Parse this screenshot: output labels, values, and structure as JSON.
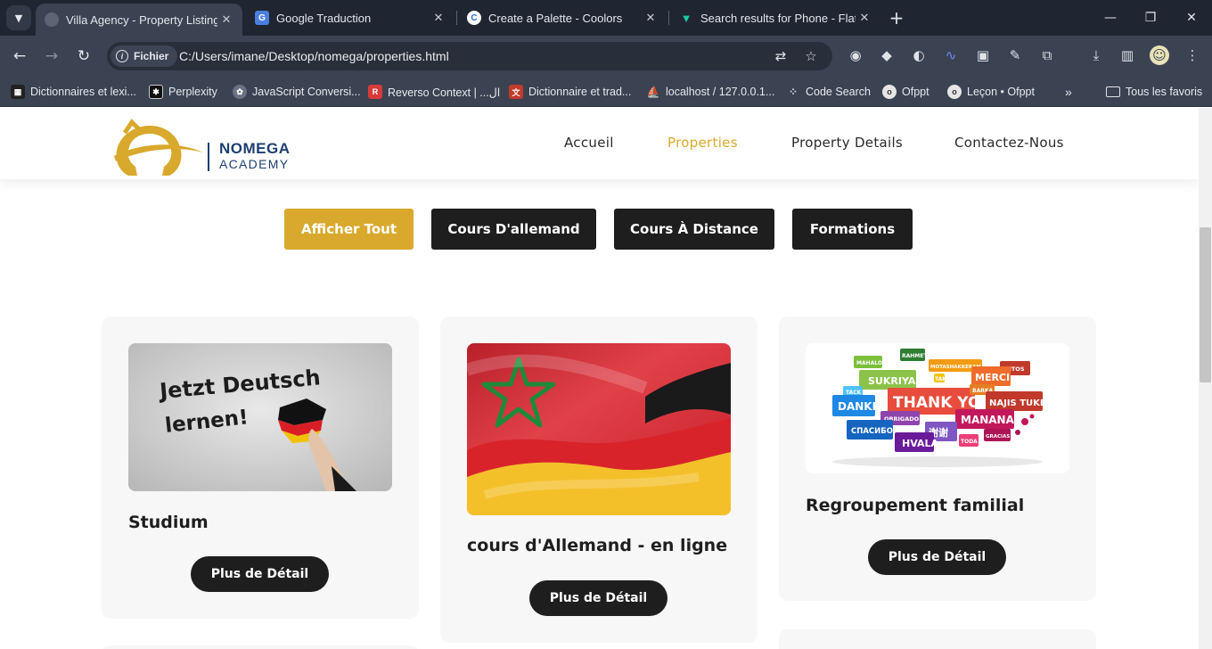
{
  "browser": {
    "tabs": [
      {
        "title": "Villa Agency - Property Listing I",
        "active": true
      },
      {
        "title": "Google Traduction",
        "active": false
      },
      {
        "title": "Create a Palette - Coolors",
        "active": false
      },
      {
        "title": "Search results for Phone - Flatic",
        "active": false
      }
    ],
    "address": {
      "chip_label": "Fichier",
      "url": "C:/Users/imane/Desktop/nomega/properties.html"
    },
    "bookmarks": [
      "Dictionnaires et lexi...",
      "Perplexity",
      "JavaScript Conversi...",
      "Reverso Context | ...ال",
      "Dictionnaire et trad...",
      "localhost / 127.0.0.1...",
      "Code Search",
      "Ofppt",
      "Leçon • Ofppt"
    ],
    "all_bookmarks_label": "Tous les favoris"
  },
  "site": {
    "logo": {
      "line1": "NOMEGA",
      "line2": "ACADEMY"
    },
    "nav": [
      "Accueil",
      "Properties",
      "Property Details",
      "Contactez-Nous"
    ],
    "active_nav": "Properties",
    "filters": [
      "Afficher Tout",
      "Cours D'allemand",
      "Cours À Distance",
      "Formations"
    ],
    "active_filter": "Afficher Tout",
    "cards": [
      {
        "title": "Studium",
        "image_text": [
          "Jetzt Deutsch",
          "lernen!"
        ],
        "button": "Plus de Détail"
      },
      {
        "title": "cours d'Allemand - en ligne",
        "button": "Plus de Détail"
      },
      {
        "title": "Regroupement familial",
        "image_words": [
          "THANK YOU",
          "DANKE",
          "MERCI",
          "SUKRIYA",
          "NAJIS TUKE",
          "MANANA",
          "СПАСИБО",
          "HVALA",
          "OBRIGADO",
          "TACK",
          "RAHMET",
          "MAHALO",
          "KIITOS",
          "GRACIAS",
          "MOTASHAKKERAM",
          "BARKA",
          "TODA",
          "TAK",
          "谢谢"
        ],
        "button": "Plus de Détail"
      }
    ]
  },
  "colors": {
    "accent": "#d8a92c",
    "dark": "#1e1e1e",
    "brand_blue": "#1d3f6e"
  }
}
